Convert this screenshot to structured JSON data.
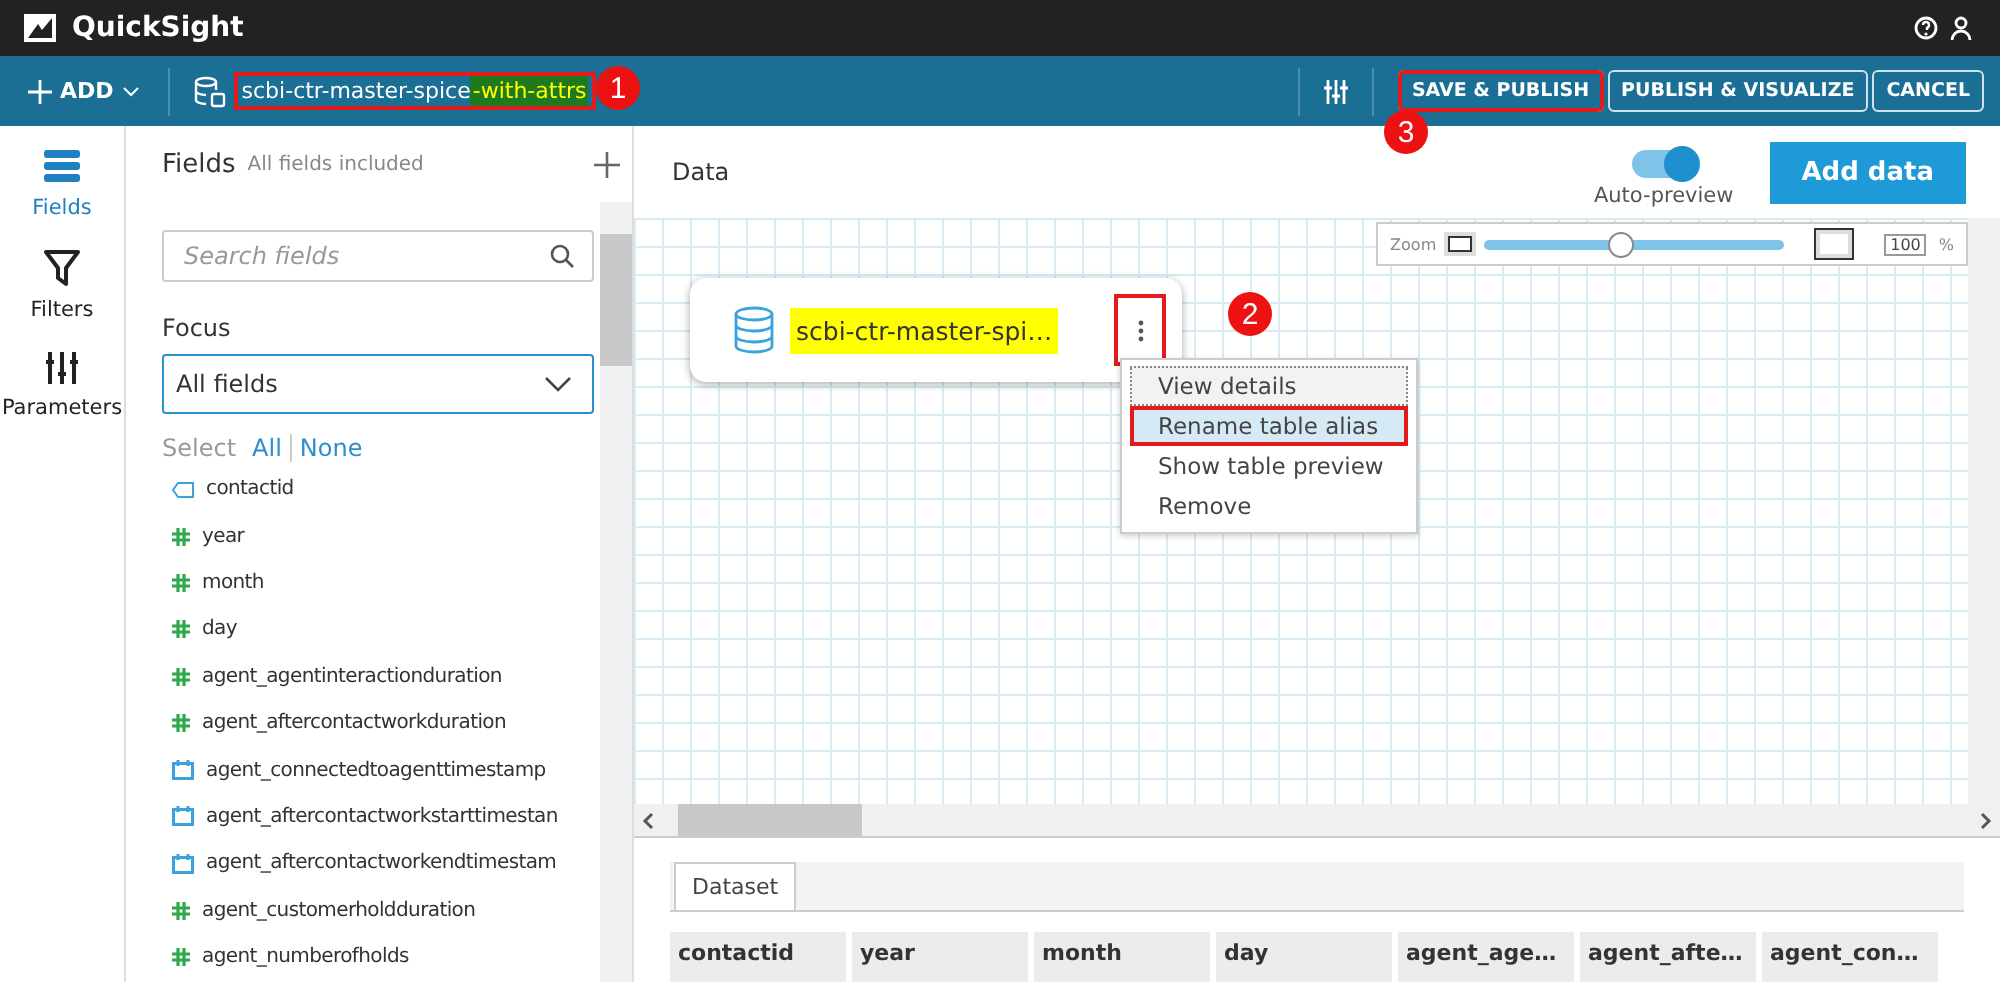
{
  "app": {
    "title": "QuickSight"
  },
  "toolbar": {
    "add_label": "ADD",
    "dataset": {
      "name": "scbi-ctr-master-spice",
      "highlight": "-with-attrs",
      "outlined": true
    },
    "buttons": [
      {
        "label": "SAVE & PUBLISH",
        "outlined": true
      },
      {
        "label": "PUBLISH & VISUALIZE",
        "outlined": false
      },
      {
        "label": "CANCEL",
        "outlined": false
      }
    ]
  },
  "callouts": [
    {
      "label": "1"
    },
    {
      "label": "2"
    },
    {
      "label": "3"
    }
  ],
  "rail": [
    {
      "label": "Fields",
      "selected": true
    },
    {
      "label": "Filters",
      "selected": false
    },
    {
      "label": "Parameters",
      "selected": false
    }
  ],
  "fields_panel": {
    "title": "Fields",
    "subtitle": "All fields included",
    "search": {
      "placeholder": "Search fields"
    },
    "focus_label": "Focus",
    "focus_value": "All fields",
    "select_label": "Select",
    "select_all": "All",
    "select_none": "None",
    "fields": [
      {
        "name": "contactid",
        "kind": "string"
      },
      {
        "name": "year",
        "kind": "number"
      },
      {
        "name": "month",
        "kind": "number"
      },
      {
        "name": "day",
        "kind": "number"
      },
      {
        "name": "agent_agentinteractionduration",
        "kind": "number"
      },
      {
        "name": "agent_aftercontactworkduration",
        "kind": "number"
      },
      {
        "name": "agent_connectedtoagenttimestamp",
        "kind": "date"
      },
      {
        "name": "agent_aftercontactworkstarttimestan",
        "kind": "date"
      },
      {
        "name": "agent_aftercontactworkendtimestam",
        "kind": "date"
      },
      {
        "name": "agent_customerholdduration",
        "kind": "number"
      },
      {
        "name": "agent_numberofholds",
        "kind": "number"
      }
    ]
  },
  "data": {
    "title": "Data",
    "auto_preview": {
      "label": "Auto-preview",
      "on": true
    },
    "add_button": "Add data",
    "zoom": {
      "label": "Zoom",
      "level": 0.45,
      "value": "100",
      "unit": "%"
    },
    "node": {
      "name": "scbi-ctr-master-spi…",
      "menu_outlined": true
    },
    "menu": [
      {
        "label": "View details",
        "selected": false,
        "focused": true,
        "outlined": false
      },
      {
        "label": "Rename table alias",
        "selected": true,
        "outlined": true
      },
      {
        "label": "Show table preview",
        "selected": false,
        "outlined": false
      },
      {
        "label": "Remove",
        "selected": false,
        "outlined": false
      }
    ]
  },
  "preview": {
    "tab": "Dataset",
    "columns": [
      "contactid",
      "year",
      "month",
      "day",
      "agent_age…",
      "agent_afte…",
      "agent_con…"
    ]
  }
}
